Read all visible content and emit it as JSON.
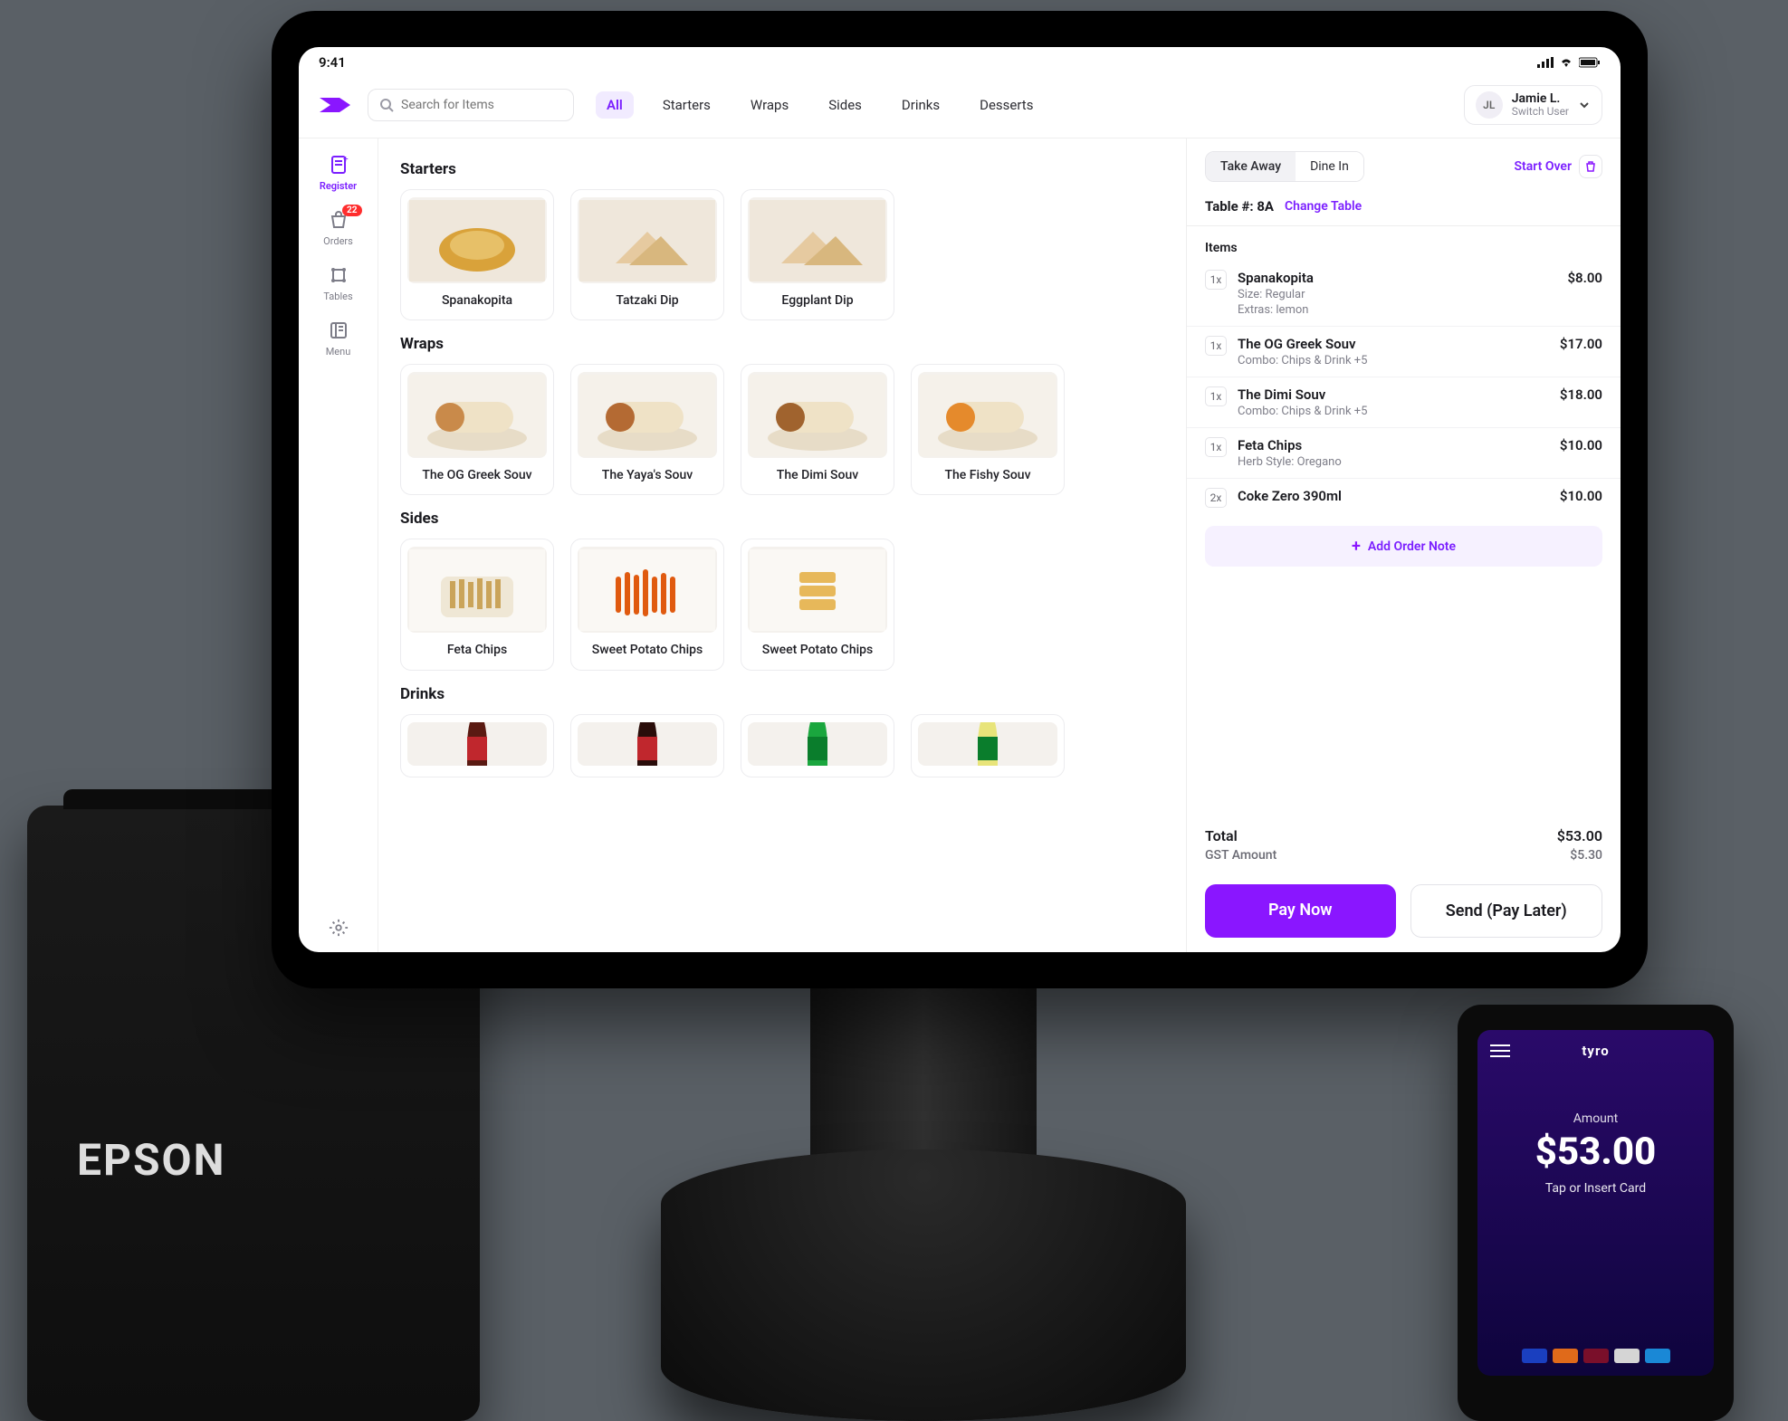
{
  "statusbar": {
    "time": "9:41"
  },
  "header": {
    "search_placeholder": "Search for Items",
    "categories": [
      "All",
      "Starters",
      "Wraps",
      "Sides",
      "Drinks",
      "Desserts"
    ],
    "active_category_index": 0,
    "user": {
      "initials": "JL",
      "name": "Jamie L.",
      "action": "Switch User"
    }
  },
  "sidebar": {
    "items": [
      {
        "label": "Register",
        "icon": "receipt-icon",
        "active": true
      },
      {
        "label": "Orders",
        "icon": "bag-icon",
        "badge": "22"
      },
      {
        "label": "Tables",
        "icon": "table-icon"
      },
      {
        "label": "Menu",
        "icon": "menu-icon"
      }
    ]
  },
  "catalog": {
    "sections": [
      {
        "title": "Starters",
        "items": [
          "Spanakopita",
          "Tatzaki Dip",
          "Eggplant Dip"
        ]
      },
      {
        "title": "Wraps",
        "items": [
          "The OG Greek Souv",
          "The Yaya's Souv",
          "The Dimi Souv",
          "The Fishy Souv"
        ]
      },
      {
        "title": "Sides",
        "items": [
          "Feta Chips",
          "Sweet Potato Chips",
          "Sweet Potato Chips"
        ]
      },
      {
        "title": "Drinks",
        "items": [
          "",
          "",
          "",
          ""
        ]
      }
    ]
  },
  "order": {
    "modes": {
      "take_away": "Take Away",
      "dine_in": "Dine In",
      "selected": 0
    },
    "start_over": "Start Over",
    "table": {
      "label_prefix": "Table #:",
      "value": "8A",
      "change": "Change Table"
    },
    "items_header": "Items",
    "lines": [
      {
        "qty": "1x",
        "name": "Spanakopita",
        "subs": [
          "Size: Regular",
          "Extras: lemon"
        ],
        "price": "$8.00"
      },
      {
        "qty": "1x",
        "name": "The OG Greek Souv",
        "subs": [
          "Combo: Chips & Drink +5"
        ],
        "price": "$17.00"
      },
      {
        "qty": "1x",
        "name": "The Dimi Souv",
        "subs": [
          "Combo: Chips & Drink +5"
        ],
        "price": "$18.00"
      },
      {
        "qty": "1x",
        "name": "Feta Chips",
        "subs": [
          "Herb Style: Oregano"
        ],
        "price": "$10.00"
      },
      {
        "qty": "2x",
        "name": "Coke Zero 390ml",
        "subs": [],
        "price": "$10.00"
      }
    ],
    "add_note": "Add Order Note",
    "total_label": "Total",
    "total_value": "$53.00",
    "gst_label": "GST Amount",
    "gst_value": "$5.30",
    "pay_now": "Pay Now",
    "pay_later": "Send (Pay Later)"
  },
  "printer": {
    "brand": "EPSON"
  },
  "terminal": {
    "brand": "tyro",
    "amount_label": "Amount",
    "amount": "$53.00",
    "tap": "Tap or Insert Card"
  },
  "colors": {
    "accent": "#8a16ff"
  }
}
